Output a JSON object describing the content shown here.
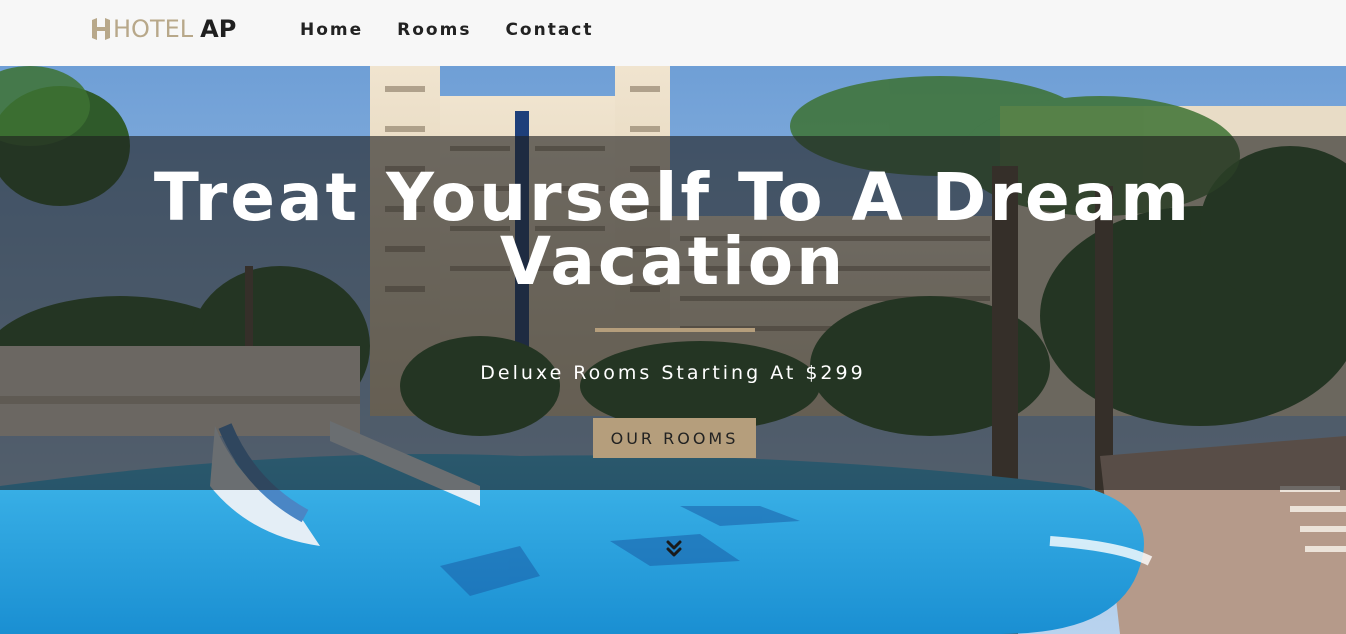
{
  "brand": {
    "logo_hotel": "HOTEL",
    "logo_ap": "AP",
    "logo_color": "#b8a88a"
  },
  "nav": {
    "items": [
      {
        "label": "Home"
      },
      {
        "label": "Rooms"
      },
      {
        "label": "Contact"
      }
    ]
  },
  "hero": {
    "title": "Treat Yourself To A Dream Vacation",
    "subtitle": "Deluxe Rooms Starting At $299",
    "button_label": "OUR ROOMS",
    "accent_color": "#b59e7c",
    "scroll_icon": "chevron-double-down-icon"
  }
}
